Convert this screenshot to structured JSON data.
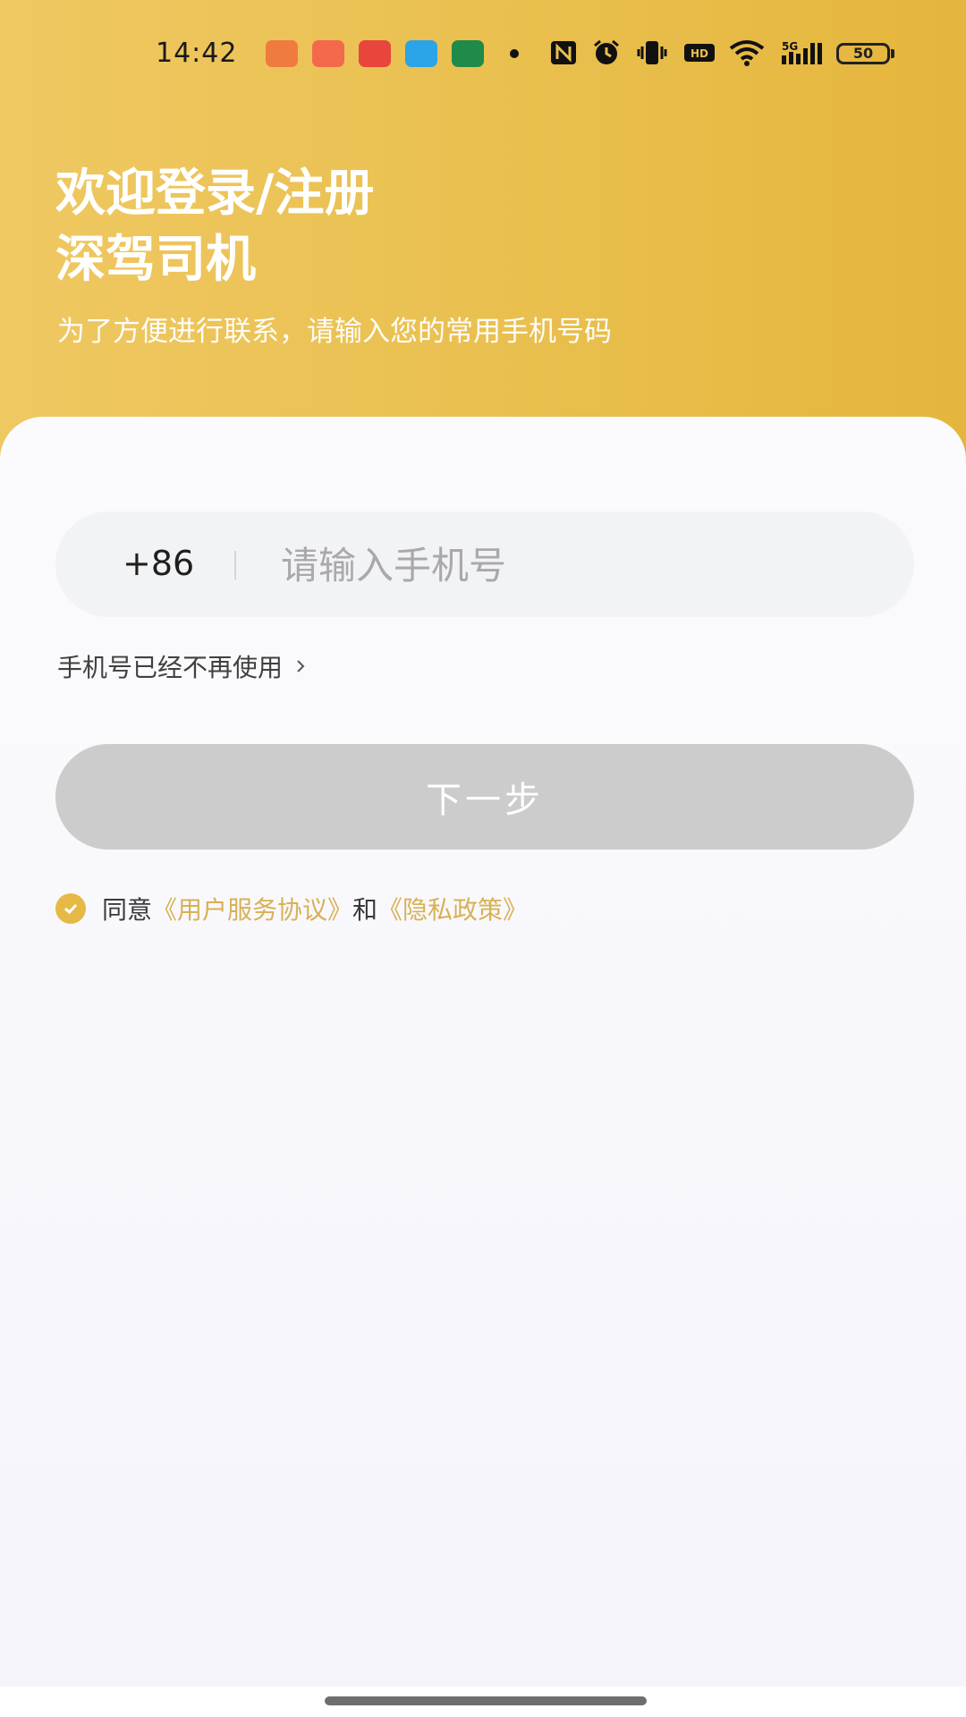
{
  "status_bar": {
    "time": "14:42",
    "battery": "50",
    "network": "5G"
  },
  "header": {
    "title_line1": "欢迎登录/注册",
    "title_line2": "深驾司机",
    "subtitle": "为了方便进行联系，请输入您的常用手机号码"
  },
  "phone": {
    "country_code": "+86",
    "placeholder": "请输入手机号",
    "value": ""
  },
  "links": {
    "no_longer_use": "手机号已经不再使用"
  },
  "next_button": {
    "label": "下一步"
  },
  "agreement": {
    "prefix": "同意",
    "user_agreement": "《用户服务协议》",
    "and": "和",
    "privacy_policy": "《隐私政策》",
    "checked": true
  },
  "colors": {
    "header_gradient_start": "#efc862",
    "header_gradient_end": "#e5b63d",
    "accent": "#e6b947",
    "link": "#d8b155",
    "button_disabled": "#cccccc"
  }
}
